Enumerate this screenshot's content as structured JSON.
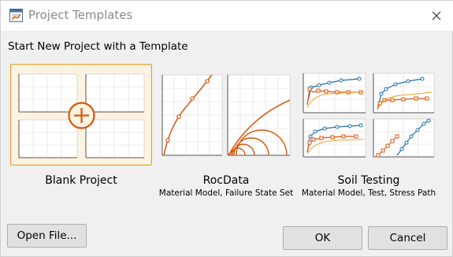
{
  "window": {
    "title": "Project Templates"
  },
  "heading": "Start New Project with a Template",
  "templates": [
    {
      "name": "Blank Project",
      "description": "",
      "selected": true,
      "icon": "blank-project-plus-icon"
    },
    {
      "name": "RocData",
      "description": "Material Model, Failure State Set",
      "selected": false,
      "icon": "rocdata-chart-icon"
    },
    {
      "name": "Soil Testing",
      "description": "Material Model, Test, Stress Path",
      "selected": false,
      "icon": "soil-testing-chart-icon"
    }
  ],
  "buttons": {
    "open_file": "Open File...",
    "ok": "OK",
    "cancel": "Cancel"
  },
  "colors": {
    "selection_border": "#e3a13c",
    "selection_fill": "#fdf3e3",
    "accent_orange": "#d9570f",
    "accent_blue": "#1f6fa8",
    "accent_light_orange": "#f0a030"
  }
}
